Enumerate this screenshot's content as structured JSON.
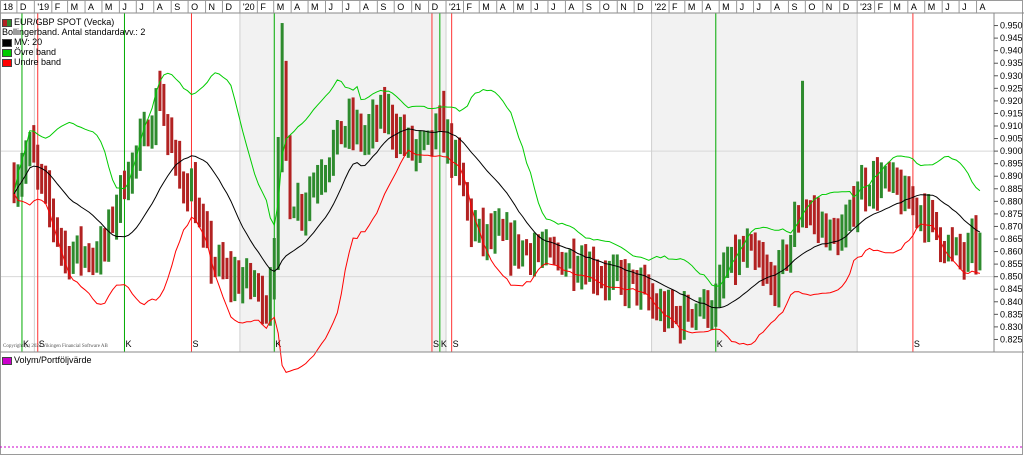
{
  "chart_data": {
    "type": "ohlc",
    "title": "EUR/GBP SPOT (Vecka)",
    "subtitle": "Bollingerband. Antal standardavv.: 2",
    "legend": [
      {
        "name": "MV: 20",
        "color": "#000000"
      },
      {
        "name": "Övre band",
        "color": "#00cc00"
      },
      {
        "name": "Undre band",
        "color": "#ff0000"
      }
    ],
    "legend_placement": "top-left",
    "ylim": [
      0.82,
      0.955
    ],
    "yticks": [
      0.825,
      0.83,
      0.835,
      0.84,
      0.845,
      0.85,
      0.855,
      0.86,
      0.865,
      0.87,
      0.875,
      0.88,
      0.885,
      0.89,
      0.895,
      0.9,
      0.905,
      0.91,
      0.915,
      0.92,
      0.925,
      0.93,
      0.935,
      0.94,
      0.945,
      0.95
    ],
    "ytick_labels": [
      "0.825",
      "0.830",
      "0.835",
      "0.840",
      "0.845",
      "0.850",
      "0.855",
      "0.860",
      "0.865",
      "0.870",
      "0.875",
      "0.880",
      "0.885",
      "0.890",
      "0.895",
      "0.900",
      "0.905",
      "0.910",
      "0.915",
      "0.920",
      "0.925",
      "0.930",
      "0.935",
      "0.940",
      "0.945",
      "0.950"
    ],
    "x_axis_labels": [
      "18",
      "D",
      "'19",
      "F",
      "M",
      "A",
      "M",
      "J",
      "J",
      "A",
      "S",
      "O",
      "N",
      "D",
      "'20",
      "F",
      "M",
      "A",
      "M",
      "J",
      "J",
      "A",
      "S",
      "O",
      "N",
      "D",
      "'21",
      "F",
      "M",
      "A",
      "M",
      "J",
      "J",
      "A",
      "S",
      "O",
      "N",
      "D",
      "'22",
      "F",
      "M",
      "A",
      "M",
      "J",
      "J",
      "A",
      "S",
      "O",
      "N",
      "D",
      "'23",
      "F",
      "M",
      "A",
      "M",
      "J",
      "J",
      "A"
    ],
    "x_start_month": "2018-11",
    "year_boundaries": [
      "2019-01",
      "2020-01",
      "2021-01",
      "2022-01",
      "2023-01"
    ],
    "shaded_years": [
      "2020",
      "2022"
    ],
    "grid": true,
    "anchor_points": [
      [
        "2018-11-26",
        0.888
      ],
      [
        "2018-12-24",
        0.901
      ],
      [
        "2019-01-14",
        0.885
      ],
      [
        "2019-02-04",
        0.872
      ],
      [
        "2019-02-25",
        0.858
      ],
      [
        "2019-03-18",
        0.86
      ],
      [
        "2019-04-15",
        0.858
      ],
      [
        "2019-05-06",
        0.862
      ],
      [
        "2019-05-27",
        0.88
      ],
      [
        "2019-06-17",
        0.892
      ],
      [
        "2019-07-15",
        0.905
      ],
      [
        "2019-08-12",
        0.922
      ],
      [
        "2019-08-26",
        0.906
      ],
      [
        "2019-09-16",
        0.888
      ],
      [
        "2019-10-07",
        0.886
      ],
      [
        "2019-10-21",
        0.87
      ],
      [
        "2019-11-11",
        0.857
      ],
      [
        "2019-12-09",
        0.85
      ],
      [
        "2019-12-30",
        0.849
      ],
      [
        "2020-01-27",
        0.847
      ],
      [
        "2020-02-17",
        0.838
      ],
      [
        "2020-03-02",
        0.863
      ],
      [
        "2020-03-16",
        0.925
      ],
      [
        "2020-03-30",
        0.88
      ],
      [
        "2020-04-20",
        0.878
      ],
      [
        "2020-05-11",
        0.888
      ],
      [
        "2020-06-01",
        0.895
      ],
      [
        "2020-06-22",
        0.905
      ],
      [
        "2020-07-13",
        0.91
      ],
      [
        "2020-08-10",
        0.905
      ],
      [
        "2020-08-31",
        0.912
      ],
      [
        "2020-09-14",
        0.915
      ],
      [
        "2020-10-05",
        0.908
      ],
      [
        "2020-11-02",
        0.9
      ],
      [
        "2020-11-30",
        0.902
      ],
      [
        "2020-12-14",
        0.908
      ],
      [
        "2021-01-04",
        0.904
      ],
      [
        "2021-01-25",
        0.89
      ],
      [
        "2021-02-15",
        0.87
      ],
      [
        "2021-03-08",
        0.865
      ],
      [
        "2021-04-05",
        0.866
      ],
      [
        "2021-05-03",
        0.861
      ],
      [
        "2021-06-07",
        0.861
      ],
      [
        "2021-07-05",
        0.857
      ],
      [
        "2021-08-02",
        0.857
      ],
      [
        "2021-08-30",
        0.856
      ],
      [
        "2021-10-04",
        0.851
      ],
      [
        "2021-11-01",
        0.848
      ],
      [
        "2021-12-06",
        0.847
      ],
      [
        "2022-01-03",
        0.838
      ],
      [
        "2022-01-31",
        0.835
      ],
      [
        "2022-02-21",
        0.833
      ],
      [
        "2022-03-14",
        0.838
      ],
      [
        "2022-04-04",
        0.838
      ],
      [
        "2022-04-25",
        0.838
      ],
      [
        "2022-05-09",
        0.852
      ],
      [
        "2022-05-30",
        0.856
      ],
      [
        "2022-06-20",
        0.86
      ],
      [
        "2022-07-11",
        0.854
      ],
      [
        "2022-08-01",
        0.846
      ],
      [
        "2022-08-22",
        0.855
      ],
      [
        "2022-09-12",
        0.87
      ],
      [
        "2022-09-26",
        0.878
      ],
      [
        "2022-10-10",
        0.875
      ],
      [
        "2022-10-31",
        0.87
      ],
      [
        "2022-11-21",
        0.865
      ],
      [
        "2022-12-12",
        0.868
      ],
      [
        "2023-01-02",
        0.885
      ],
      [
        "2023-01-23",
        0.887
      ],
      [
        "2023-02-13",
        0.888
      ],
      [
        "2023-03-06",
        0.886
      ],
      [
        "2023-03-27",
        0.88
      ],
      [
        "2023-04-17",
        0.878
      ],
      [
        "2023-05-08",
        0.873
      ],
      [
        "2023-05-29",
        0.865
      ],
      [
        "2023-06-19",
        0.86
      ],
      [
        "2023-07-10",
        0.857
      ],
      [
        "2023-07-24",
        0.862
      ],
      [
        "2023-08-07",
        0.86
      ]
    ],
    "spikes": [
      [
        "2020-03-16",
        0.951
      ],
      [
        "2022-09-26",
        0.928
      ],
      [
        "2019-08-12",
        0.932
      ],
      [
        "2020-12-28",
        0.924
      ]
    ],
    "signals": [
      {
        "date": "2018-12-10",
        "type": "K"
      },
      {
        "date": "2019-01-07",
        "type": "S"
      },
      {
        "date": "2019-06-10",
        "type": "K"
      },
      {
        "date": "2019-10-07",
        "type": "S"
      },
      {
        "date": "2020-03-02",
        "type": "K"
      },
      {
        "date": "2020-12-07",
        "type": "S"
      },
      {
        "date": "2020-12-21",
        "type": "K"
      },
      {
        "date": "2021-01-11",
        "type": "S"
      },
      {
        "date": "2022-04-25",
        "type": "K"
      },
      {
        "date": "2023-04-10",
        "type": "S"
      }
    ],
    "ma_period": 20,
    "std_multiplier": 2,
    "colors": {
      "up": "#2e8b2e",
      "down": "#b22222",
      "ma": "#000000",
      "upper": "#00cc00",
      "lower": "#ff0000",
      "buy_signal": "#00aa00",
      "sell_signal": "#ff3333",
      "shade": "#f2f2f2"
    }
  },
  "copyright": "Copyright (c) 2023 Vikingen Financial Software AB",
  "volume_panel": {
    "label": "Volym/Portföljvärde",
    "color": "#cc00cc"
  }
}
